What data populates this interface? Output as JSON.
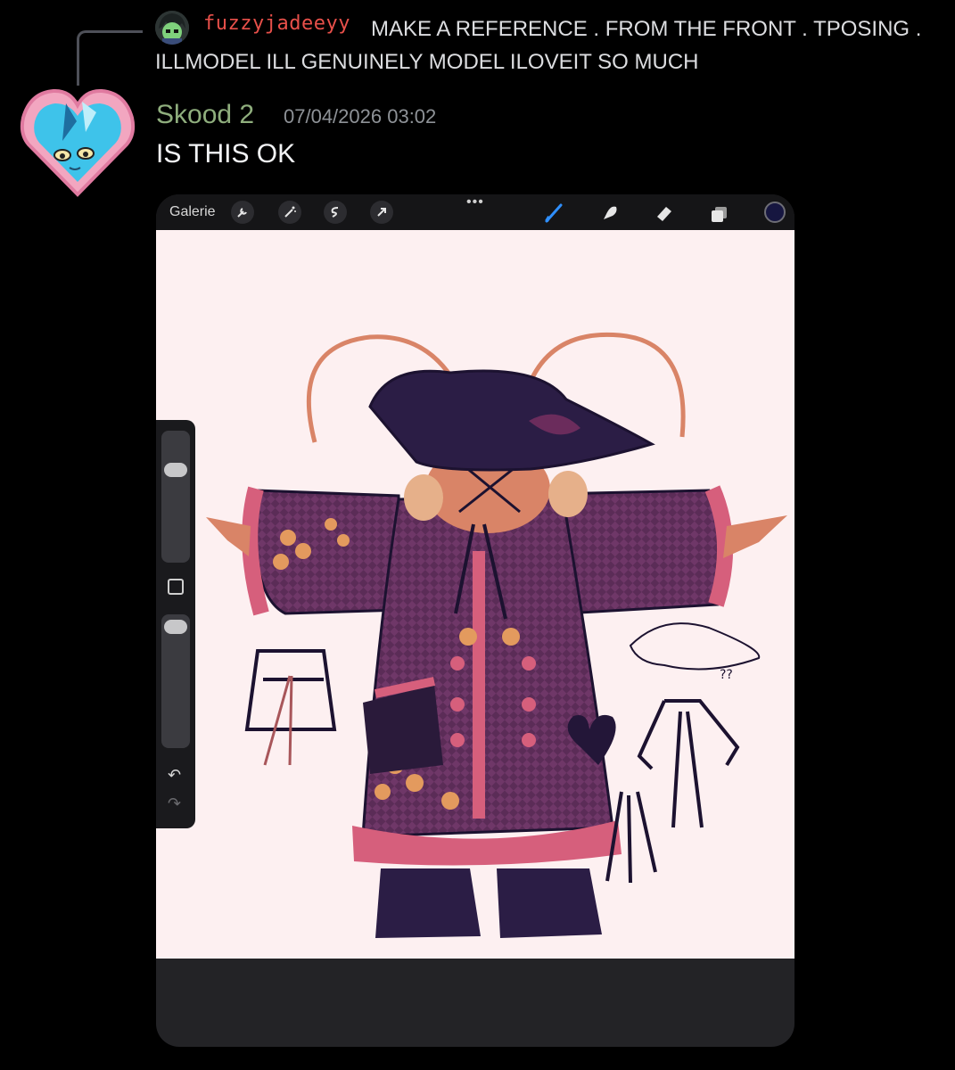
{
  "reply": {
    "username": "fuzzyjadeeyy",
    "text": "MAKE A REFERENCE . FROM THE FRONT . TPOSING . ILLMODEL ILL GENUINELY MODEL ILOVEIT SO MUCH"
  },
  "message": {
    "author": "Skood 2",
    "timestamp": "07/04/2026 03:02",
    "text": "IS THIS OK",
    "author_color": "#8fae7d"
  },
  "app": {
    "gallery_label": "Galerie",
    "more_dots": "•••",
    "left_tools": [
      "wrench-icon",
      "magic-wand-icon",
      "selection-icon",
      "transform-arrow-icon"
    ],
    "right_tools": [
      "brush-icon",
      "smudge-icon",
      "eraser-icon",
      "layers-icon"
    ],
    "active_color": "#161640",
    "undo_glyph": "↶",
    "redo_glyph": "↷",
    "sketch_note": "??"
  }
}
